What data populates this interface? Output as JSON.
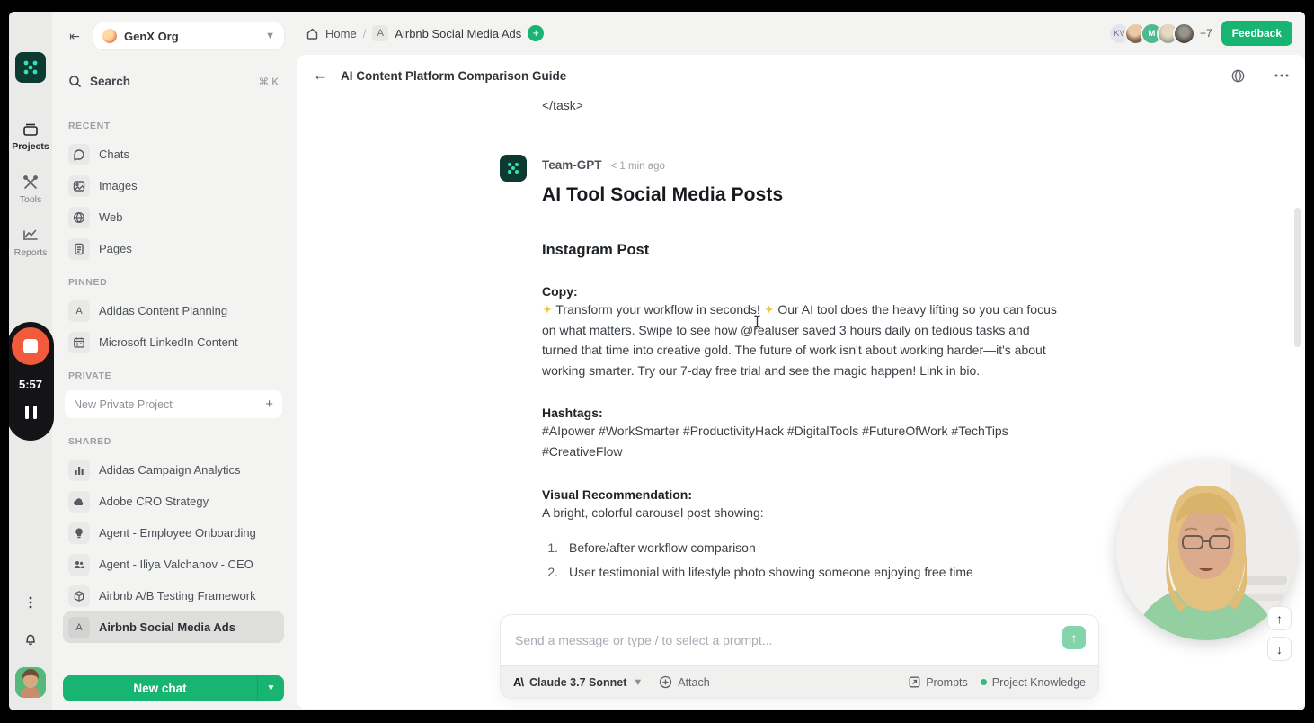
{
  "colors": {
    "accent_green": "#17b472",
    "logo_green": "#0c3a30",
    "record_orange": "#f15b3c",
    "knowledge_dot": "#2fb98b"
  },
  "rail": {
    "items": [
      {
        "label": "Projects"
      },
      {
        "label": "Tools"
      },
      {
        "label": "Reports"
      }
    ]
  },
  "recorder": {
    "time": "5:57"
  },
  "sidebar": {
    "org": {
      "name": "GenX Org"
    },
    "search": {
      "label": "Search",
      "shortcut": "⌘ K"
    },
    "recent": {
      "title": "RECENT",
      "items": [
        {
          "label": "Chats"
        },
        {
          "label": "Images"
        },
        {
          "label": "Web"
        },
        {
          "label": "Pages"
        }
      ]
    },
    "pinned": {
      "title": "PINNED",
      "items": [
        {
          "label": "Adidas Content Planning",
          "badge": "A"
        },
        {
          "label": "Microsoft LinkedIn Content"
        }
      ]
    },
    "private": {
      "title": "PRIVATE",
      "new_project_label": "New Private Project",
      "add": "+"
    },
    "shared": {
      "title": "SHARED",
      "items": [
        {
          "label": "Adidas Campaign Analytics"
        },
        {
          "label": "Adobe CRO Strategy"
        },
        {
          "label": "Agent - Employee Onboarding"
        },
        {
          "label": "Agent - Iliya Valchanov - CEO"
        },
        {
          "label": "Airbnb A/B Testing Framework"
        },
        {
          "label": "Airbnb Social Media Ads",
          "badge": "A",
          "selected": true
        }
      ]
    },
    "new_chat_label": "New chat"
  },
  "topbar": {
    "breadcrumb": {
      "home": "Home",
      "separator": "/",
      "badge_letter": "A",
      "current": "Airbnb Social Media Ads",
      "add": "+"
    },
    "avatars": {
      "first_initials": "KV",
      "third_initial": "M"
    },
    "overflow_count": "+7",
    "feedback_label": "Feedback"
  },
  "chat": {
    "title": "AI Content Platform Comparison Guide",
    "task_close_tag": "</task>",
    "message": {
      "author": "Team-GPT",
      "timestamp": "< 1 min ago",
      "heading": "AI Tool Social Media Posts",
      "instagram_heading": "Instagram Post",
      "copy_label": "Copy:",
      "sparkle": "✦",
      "copy_part1": "Transform your workflow in seconds!",
      "copy_part2": "Our AI tool does the heavy lifting so you can focus on what matters. Swipe to see how @realuser saved 3 hours daily on tedious tasks and turned that time into creative gold. The future of work isn't about working harder—it's about working smarter. Try our 7-day free trial and see the magic happen! Link in bio.",
      "hashtags_label": "Hashtags:",
      "hashtags_text": "#AIpower #WorkSmarter #ProductivityHack #DigitalTools #FutureOfWork #TechTips #CreativeFlow",
      "visual_label": "Visual Recommendation:",
      "visual_intro": "A bright, colorful carousel post showing:",
      "visual_list": [
        {
          "num": "1.",
          "text": "Before/after workflow comparison"
        },
        {
          "num": "2.",
          "text": "User testimonial with lifestyle photo showing someone enjoying free time"
        }
      ]
    }
  },
  "composer": {
    "placeholder": "Send a message or type / to select a prompt...",
    "model_logo": "A\\",
    "model": "Claude 3.7 Sonnet",
    "attach_label": "Attach",
    "prompts_label": "Prompts",
    "knowledge_label": "Project Knowledge"
  }
}
